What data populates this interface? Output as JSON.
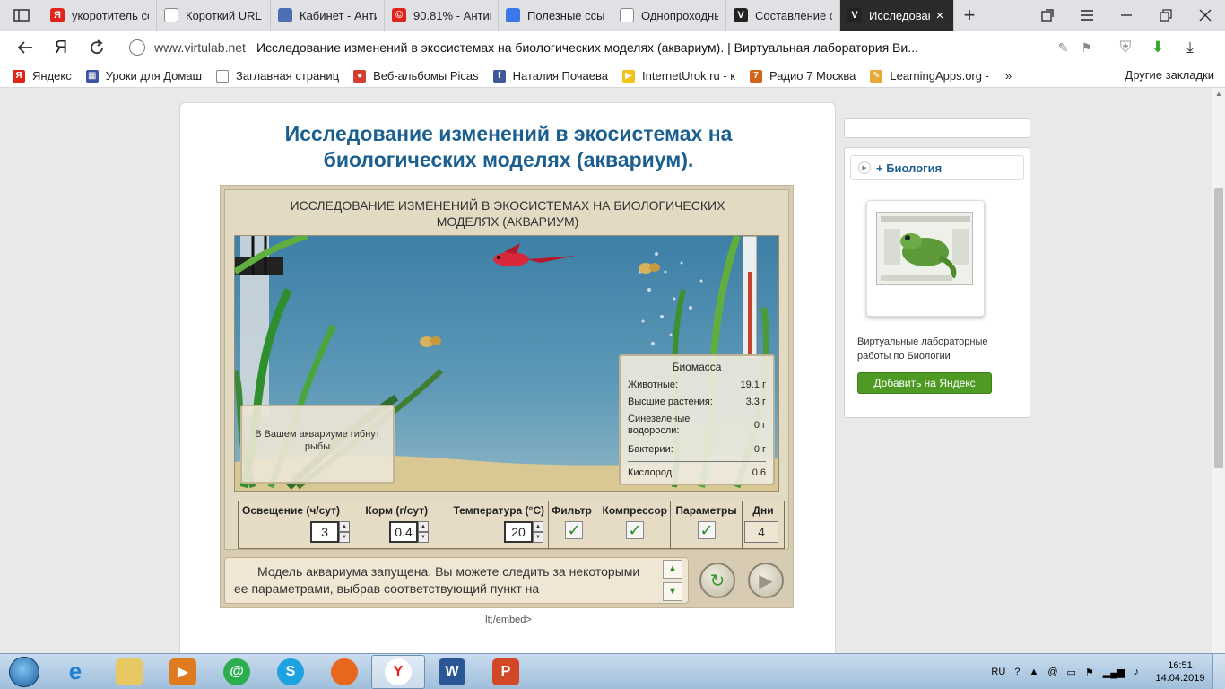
{
  "tabs": [
    {
      "label": "укоротитель сс",
      "icon": "yandex-icon",
      "color": "#e2231a",
      "glyph": "Я"
    },
    {
      "label": "Короткий URL",
      "icon": "document-icon",
      "color": "#ffffff",
      "glyph": ""
    },
    {
      "label": "Кабинет - Анти",
      "icon": "shield-icon",
      "color": "#4a6fb5",
      "glyph": ""
    },
    {
      "label": "90.81% - Антип",
      "icon": "copyright-icon",
      "color": "#e2231a",
      "glyph": "©"
    },
    {
      "label": "Полезные ссыл",
      "icon": "doc-blue-icon",
      "color": "#3b78e7",
      "glyph": ""
    },
    {
      "label": "Однопроходнь",
      "icon": "document-icon",
      "color": "#ffffff",
      "glyph": ""
    },
    {
      "label": "Составление с",
      "icon": "virtulab-icon",
      "color": "#222222",
      "glyph": "V"
    },
    {
      "label": "Исследован",
      "icon": "virtulab-icon",
      "color": "#222222",
      "glyph": "V",
      "active": true
    }
  ],
  "address": {
    "host": "www.virtulab.net",
    "title": "Исследование изменений в экосистемах на биологических моделях (аквариум). | Виртуальная лаборатория Ви..."
  },
  "bookmarks": [
    {
      "label": "Яндекс",
      "color": "#e2231a",
      "glyph": "Я"
    },
    {
      "label": "Уроки для Домаш",
      "color": "#3b55a0",
      "glyph": "▦"
    },
    {
      "label": "Заглавная страниц",
      "color": "#ffffff",
      "glyph": ""
    },
    {
      "label": "Веб-альбомы Picas",
      "color": "#d23f31",
      "glyph": "●"
    },
    {
      "label": "Наталия Почаева",
      "color": "#3b5998",
      "glyph": "f"
    },
    {
      "label": "InternetUrok.ru - к",
      "color": "#f0c419",
      "glyph": "▶"
    },
    {
      "label": "Радио 7 Москва",
      "color": "#d4641c",
      "glyph": "7"
    },
    {
      "label": "LearningApps.org -",
      "color": "#e8a93a",
      "glyph": "✎"
    }
  ],
  "bookmarks_other": "Другие закладки",
  "page_title": "Исследование изменений в экосистемах на биологических моделях (аквариум).",
  "sim": {
    "title": "ИССЛЕДОВАНИЕ ИЗМЕНЕНИЙ В ЭКОСИСТЕМАХ НА БИОЛОГИЧЕСКИХ МОДЕЛЯХ (АКВАРИУМ)",
    "note": "В Вашем аквариуме гибнут рыбы",
    "biomass": {
      "title": "Биомасса",
      "animals_label": "Животные:",
      "animals_value": "19.1 г",
      "plants_label": "Высшие растения:",
      "plants_value": "3.3 г",
      "algae_label": "Синезеленые водоросли:",
      "algae_value": "0 г",
      "bacteria_label": "Бактерии:",
      "bacteria_value": "0 г",
      "oxygen_label": "Кислород:",
      "oxygen_value": "0.6"
    },
    "controls": {
      "light_label": "Освещение (ч/сут)",
      "light_value": "3",
      "food_label": "Корм (г/сут)",
      "food_value": "0.4",
      "temp_label": "Температура (°С)",
      "temp_value": "20",
      "filter_label": "Фильтр",
      "filter_checked": true,
      "compressor_label": "Компрессор",
      "compressor_checked": true,
      "params_label": "Параметры",
      "params_checked": true,
      "days_label": "Дни",
      "days_value": "4"
    },
    "message": "Модель аквариума запущена. Вы можете следить за некоторыми ее параметрами, выбрав соответствующий пункт на"
  },
  "embed_caption": "lt;/embed>",
  "sidebar": {
    "category": "+ Биология",
    "description": "Виртуальные лабораторные работы по Биологии",
    "button": "Добавить на Яндекс"
  },
  "taskbar": {
    "lang": "RU",
    "time": "16:51",
    "date": "14.04.2019"
  }
}
